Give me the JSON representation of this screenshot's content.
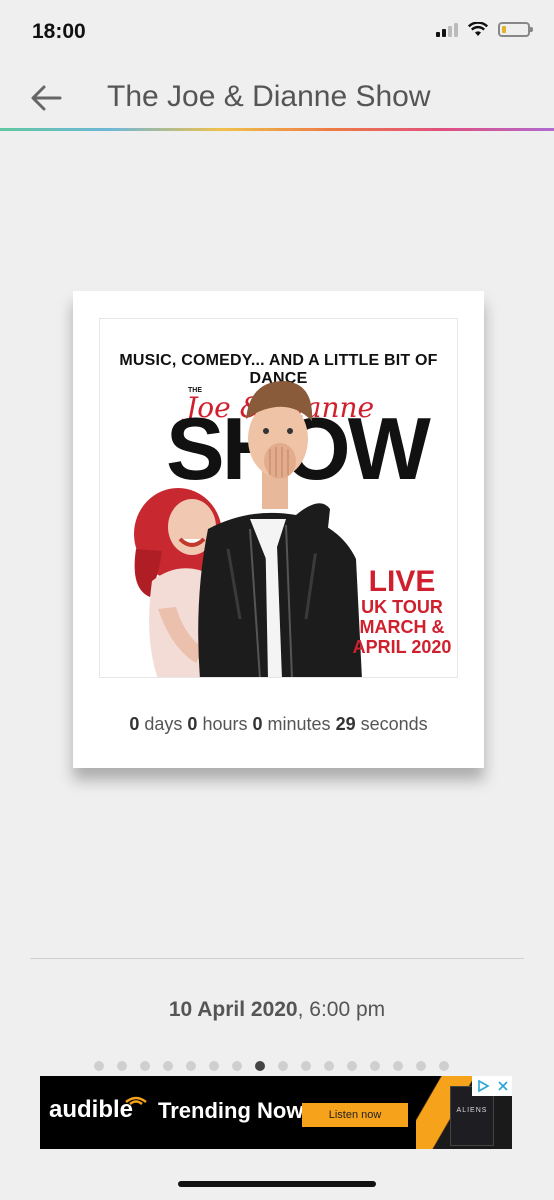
{
  "status_bar": {
    "time": "18:00",
    "icons": [
      "signal-icon",
      "wifi-icon",
      "battery-icon"
    ]
  },
  "header": {
    "back_icon": "arrow-left-icon",
    "title": "The Joe & Dianne Show"
  },
  "card": {
    "poster": {
      "tagline": "MUSIC, COMEDY... AND A LITTLE BIT OF DANCE",
      "the": "THE",
      "title_script": "Joe & Dianne",
      "title_block": "SHOW",
      "live": "LIVE",
      "tour_lines": [
        "UK TOUR",
        "MARCH &",
        "APRIL 2020"
      ]
    },
    "countdown": {
      "days": "0",
      "days_label": "days",
      "hours": "0",
      "hours_label": "hours",
      "minutes": "0",
      "minutes_label": "minutes",
      "seconds": "29",
      "seconds_label": "seconds"
    }
  },
  "event": {
    "date_bold": "10 April 2020",
    "time": ", 6:00 pm"
  },
  "pager": {
    "count": 16,
    "active_index": 7
  },
  "ad": {
    "brand": "audible",
    "headline": "Trending Now",
    "cta": "Listen now",
    "book_title": "ALIENS"
  },
  "colors": {
    "background": "#efefef",
    "poster_red": "#d0202e",
    "ad_orange": "#f7a21b"
  }
}
